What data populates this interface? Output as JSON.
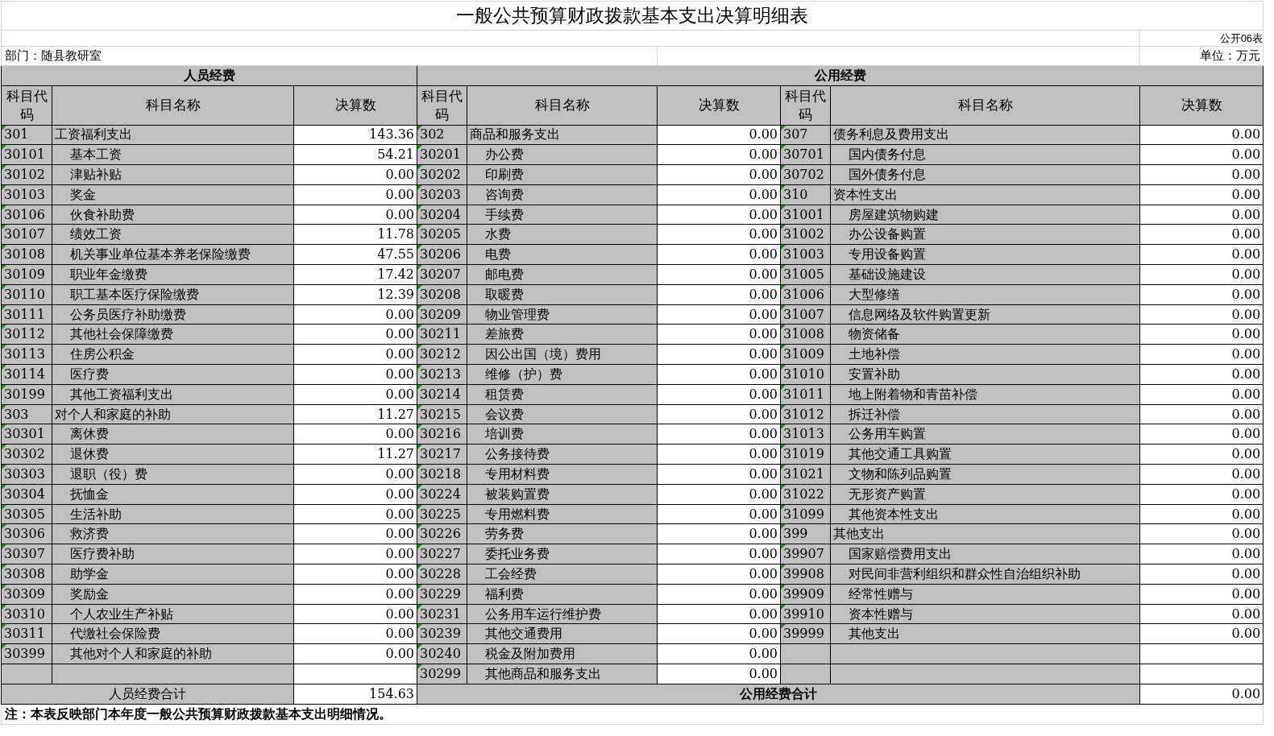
{
  "title": "一般公共预算财政拨款基本支出决算明细表",
  "form_number": "公开06表",
  "department": "部门：随县教研室",
  "unit": "单位：万元",
  "personnel": {
    "heading": "人员经费",
    "columns": [
      "科目代码",
      "科目名称",
      "决算数"
    ],
    "items": [
      {
        "code": "301",
        "name": "工资福利支出",
        "amount": "143.36",
        "children": [
          {
            "code": "30101",
            "name": "基本工资",
            "amount": "54.21"
          },
          {
            "code": "30102",
            "name": "津贴补贴",
            "amount": "0.00"
          },
          {
            "code": "30103",
            "name": "奖金",
            "amount": "0.00"
          },
          {
            "code": "30106",
            "name": "伙食补助费",
            "amount": "0.00"
          },
          {
            "code": "30107",
            "name": "绩效工资",
            "amount": "11.78"
          },
          {
            "code": "30108",
            "name": "机关事业单位基本养老保险缴费",
            "amount": "47.55"
          },
          {
            "code": "30109",
            "name": "职业年金缴费",
            "amount": "17.42"
          },
          {
            "code": "30110",
            "name": "职工基本医疗保险缴费",
            "amount": "12.39"
          },
          {
            "code": "30111",
            "name": "公务员医疗补助缴费",
            "amount": "0.00"
          },
          {
            "code": "30112",
            "name": "其他社会保障缴费",
            "amount": "0.00"
          },
          {
            "code": "30113",
            "name": "住房公积金",
            "amount": "0.00"
          },
          {
            "code": "30114",
            "name": "医疗费",
            "amount": "0.00"
          },
          {
            "code": "30199",
            "name": "其他工资福利支出",
            "amount": "0.00"
          }
        ]
      },
      {
        "code": "303",
        "name": "对个人和家庭的补助",
        "amount": "11.27",
        "children": [
          {
            "code": "30301",
            "name": "离休费",
            "amount": "0.00"
          },
          {
            "code": "30302",
            "name": "退休费",
            "amount": "11.27"
          },
          {
            "code": "30303",
            "name": "退职（役）费",
            "amount": "0.00"
          },
          {
            "code": "30304",
            "name": "抚恤金",
            "amount": "0.00"
          },
          {
            "code": "30305",
            "name": "生活补助",
            "amount": "0.00"
          },
          {
            "code": "30306",
            "name": "救济费",
            "amount": "0.00"
          },
          {
            "code": "30307",
            "name": "医疗费补助",
            "amount": "0.00"
          },
          {
            "code": "30308",
            "name": "助学金",
            "amount": "0.00"
          },
          {
            "code": "30309",
            "name": "奖励金",
            "amount": "0.00"
          },
          {
            "code": "30310",
            "name": "个人农业生产补贴",
            "amount": "0.00"
          },
          {
            "code": "30311",
            "name": "代缴社会保险费",
            "amount": "0.00"
          },
          {
            "code": "30399",
            "name": "其他对个人和家庭的补助",
            "amount": "0.00"
          }
        ]
      }
    ],
    "total_label": "人员经费合计",
    "total": "154.63"
  },
  "public": {
    "heading": "公用经费",
    "columns": [
      "科目代码",
      "科目名称",
      "决算数",
      "科目代码",
      "科目名称",
      "决算数"
    ],
    "group_1": [
      {
        "code": "302",
        "name": "商品和服务支出",
        "amount": "0.00",
        "children": [
          {
            "code": "30201",
            "name": "办公费",
            "amount": "0.00"
          },
          {
            "code": "30202",
            "name": "印刷费",
            "amount": "0.00"
          },
          {
            "code": "30203",
            "name": "咨询费",
            "amount": "0.00"
          },
          {
            "code": "30204",
            "name": "手续费",
            "amount": "0.00"
          },
          {
            "code": "30205",
            "name": "水费",
            "amount": "0.00"
          },
          {
            "code": "30206",
            "name": "电费",
            "amount": "0.00"
          },
          {
            "code": "30207",
            "name": "邮电费",
            "amount": "0.00"
          },
          {
            "code": "30208",
            "name": "取暖费",
            "amount": "0.00"
          },
          {
            "code": "30209",
            "name": "物业管理费",
            "amount": "0.00"
          },
          {
            "code": "30211",
            "name": "差旅费",
            "amount": "0.00"
          },
          {
            "code": "30212",
            "name": "因公出国（境）费用",
            "amount": "0.00"
          },
          {
            "code": "30213",
            "name": "维修（护）费",
            "amount": "0.00"
          },
          {
            "code": "30214",
            "name": "租赁费",
            "amount": "0.00"
          },
          {
            "code": "30215",
            "name": "会议费",
            "amount": "0.00"
          },
          {
            "code": "30216",
            "name": "培训费",
            "amount": "0.00"
          },
          {
            "code": "30217",
            "name": "公务接待费",
            "amount": "0.00"
          },
          {
            "code": "30218",
            "name": "专用材料费",
            "amount": "0.00"
          },
          {
            "code": "30224",
            "name": "被装购置费",
            "amount": "0.00"
          },
          {
            "code": "30225",
            "name": "专用燃料费",
            "amount": "0.00"
          },
          {
            "code": "30226",
            "name": "劳务费",
            "amount": "0.00"
          },
          {
            "code": "30227",
            "name": "委托业务费",
            "amount": "0.00"
          },
          {
            "code": "30228",
            "name": "工会经费",
            "amount": "0.00"
          },
          {
            "code": "30229",
            "name": "福利费",
            "amount": "0.00"
          },
          {
            "code": "30231",
            "name": "公务用车运行维护费",
            "amount": "0.00"
          },
          {
            "code": "30239",
            "name": "其他交通费用",
            "amount": "0.00"
          },
          {
            "code": "30240",
            "name": "税金及附加费用",
            "amount": "0.00"
          },
          {
            "code": "30299",
            "name": "其他商品和服务支出",
            "amount": "0.00"
          }
        ]
      }
    ],
    "group_2": [
      {
        "code": "307",
        "name": "债务利息及费用支出",
        "amount": "0.00",
        "children": [
          {
            "code": "30701",
            "name": "国内债务付息",
            "amount": "0.00"
          },
          {
            "code": "30702",
            "name": "国外债务付息",
            "amount": "0.00"
          }
        ]
      },
      {
        "code": "310",
        "name": "资本性支出",
        "amount": "0.00",
        "children": [
          {
            "code": "31001",
            "name": "房屋建筑物购建",
            "amount": "0.00"
          },
          {
            "code": "31002",
            "name": "办公设备购置",
            "amount": "0.00"
          },
          {
            "code": "31003",
            "name": "专用设备购置",
            "amount": "0.00"
          },
          {
            "code": "31005",
            "name": "基础设施建设",
            "amount": "0.00"
          },
          {
            "code": "31006",
            "name": "大型修缮",
            "amount": "0.00"
          },
          {
            "code": "31007",
            "name": "信息网络及软件购置更新",
            "amount": "0.00"
          },
          {
            "code": "31008",
            "name": "物资储备",
            "amount": "0.00"
          },
          {
            "code": "31009",
            "name": "土地补偿",
            "amount": "0.00"
          },
          {
            "code": "31010",
            "name": "安置补助",
            "amount": "0.00"
          },
          {
            "code": "31011",
            "name": "地上附着物和青苗补偿",
            "amount": "0.00"
          },
          {
            "code": "31012",
            "name": "拆迁补偿",
            "amount": "0.00"
          },
          {
            "code": "31013",
            "name": "公务用车购置",
            "amount": "0.00"
          },
          {
            "code": "31019",
            "name": "其他交通工具购置",
            "amount": "0.00"
          },
          {
            "code": "31021",
            "name": "文物和陈列品购置",
            "amount": "0.00"
          },
          {
            "code": "31022",
            "name": "无形资产购置",
            "amount": "0.00"
          },
          {
            "code": "31099",
            "name": "其他资本性支出",
            "amount": "0.00"
          }
        ]
      },
      {
        "code": "399",
        "name": "其他支出",
        "amount": "0.00",
        "children": [
          {
            "code": "39907",
            "name": "国家赔偿费用支出",
            "amount": "0.00"
          },
          {
            "code": "39908",
            "name": "对民间非营利组织和群众性自治组织补助",
            "amount": "0.00"
          },
          {
            "code": "39909",
            "name": "经常性赠与",
            "amount": "0.00"
          },
          {
            "code": "39910",
            "name": "资本性赠与",
            "amount": "0.00"
          },
          {
            "code": "39999",
            "name": "其他支出",
            "amount": "0.00"
          }
        ]
      }
    ],
    "total_label": "公用经费合计",
    "total": "0.00"
  },
  "note": "注：本表反映部门本年度一般公共预算财政拨款基本支出明细情况。"
}
